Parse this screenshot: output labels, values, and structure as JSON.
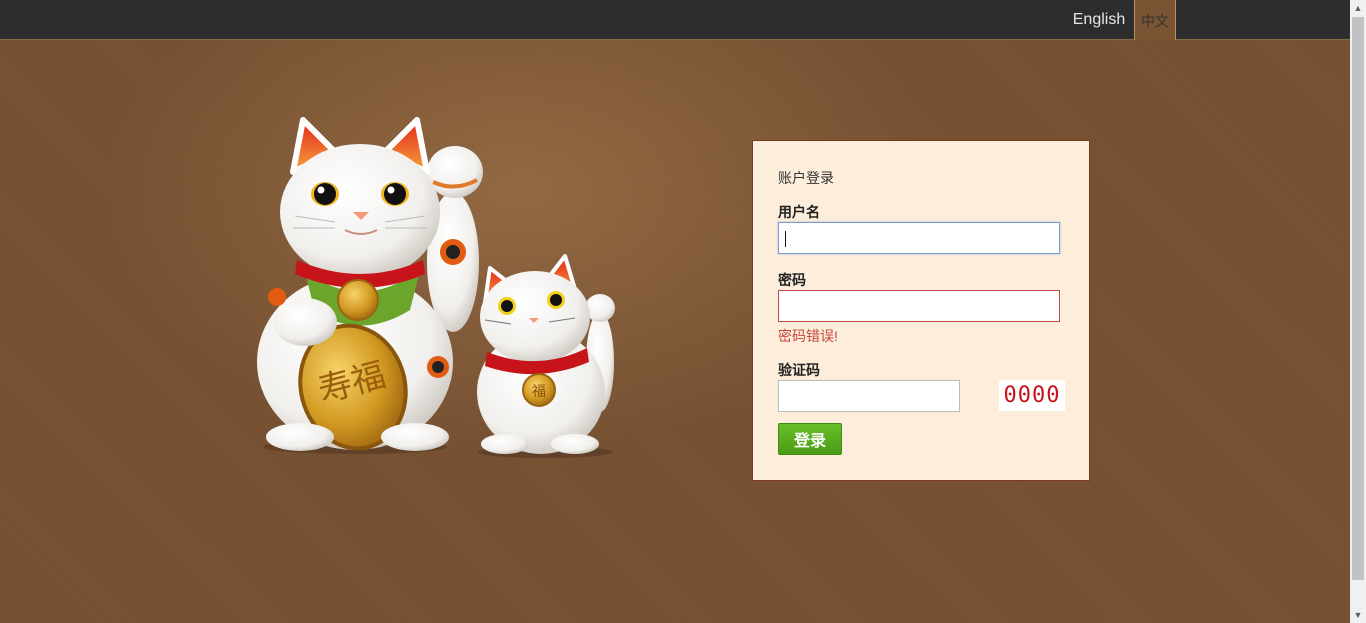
{
  "topbar": {
    "lang_english": "English",
    "lang_chinese": "中文"
  },
  "illustration": {
    "big_cat_coin_glyph": "寿福",
    "bell_glyph": "福"
  },
  "login": {
    "title": "账户登录",
    "username_label": "用户名",
    "username_value": "",
    "password_label": "密码",
    "password_value": "",
    "password_error": "密码错误!",
    "captcha_label": "验证码",
    "captcha_value": "",
    "captcha_image_text": "0000",
    "submit_label": "登录"
  },
  "colors": {
    "background": "#785233",
    "topbar": "#2d2d2d",
    "card_bg": "#fdeedb",
    "card_border": "#7a3a1c",
    "error": "#c9453f",
    "button": "#5aad1e"
  }
}
